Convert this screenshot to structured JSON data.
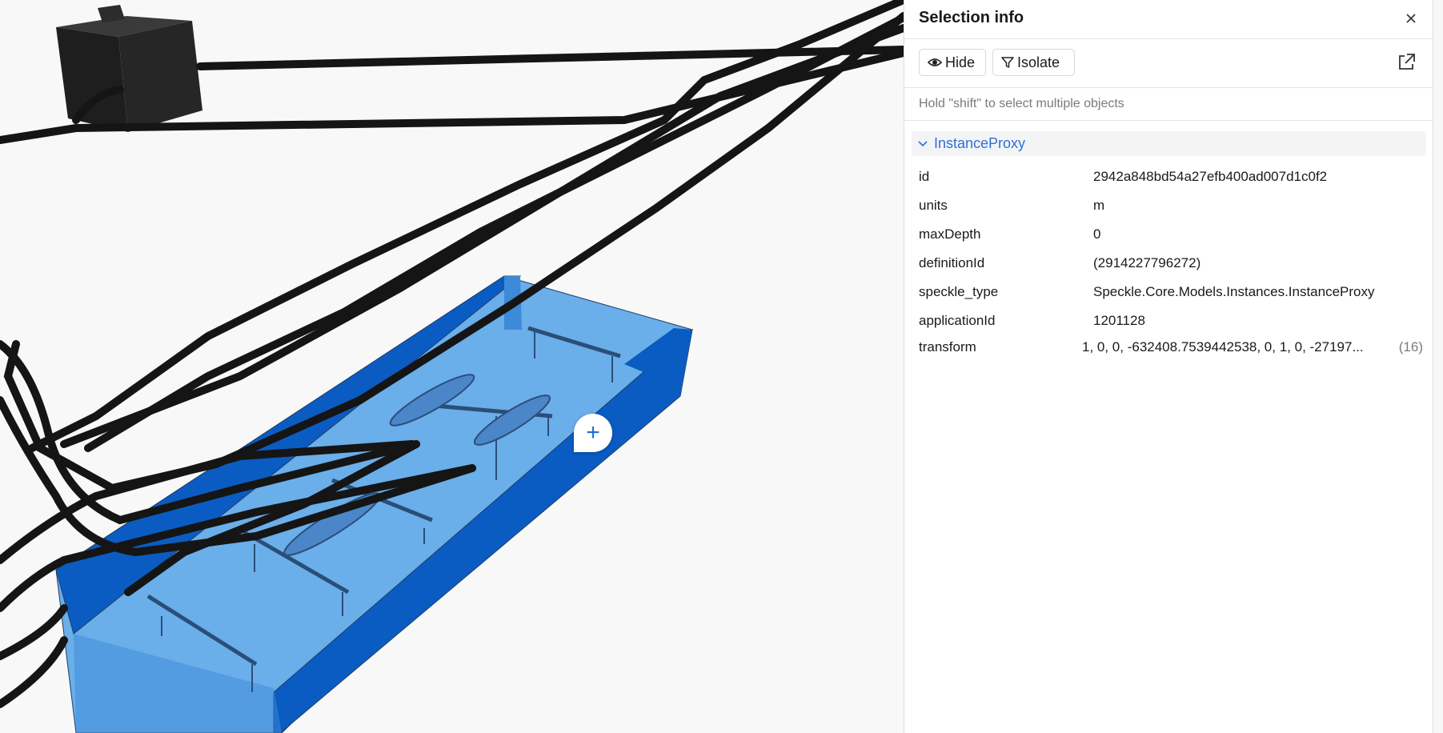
{
  "panel": {
    "title": "Selection info",
    "hide_label": "Hide",
    "isolate_label": "Isolate",
    "hint": "Hold \"shift\" to select multiple objects",
    "group": {
      "label": "InstanceProxy",
      "properties": [
        {
          "key": "id",
          "value": "2942a848bd54a27efb400ad007d1c0f2"
        },
        {
          "key": "units",
          "value": "m"
        },
        {
          "key": "maxDepth",
          "value": "0"
        },
        {
          "key": "definitionId",
          "value": "(2914227796272)"
        },
        {
          "key": "speckle_type",
          "value": "Speckle.Core.Models.Instances.InstanceProxy"
        },
        {
          "key": "applicationId",
          "value": "1201128"
        },
        {
          "key": "transform",
          "value": "1, 0, 0, -632408.7539442538, 0, 1, 0, -27197...",
          "count": "(16)"
        }
      ]
    }
  },
  "viewer": {
    "add_icon": "+",
    "colors": {
      "selection_fill": "#6aaeea",
      "selection_dark": "#0a5cc2",
      "cable": "#151515",
      "accent": "#2f6fd6"
    }
  }
}
